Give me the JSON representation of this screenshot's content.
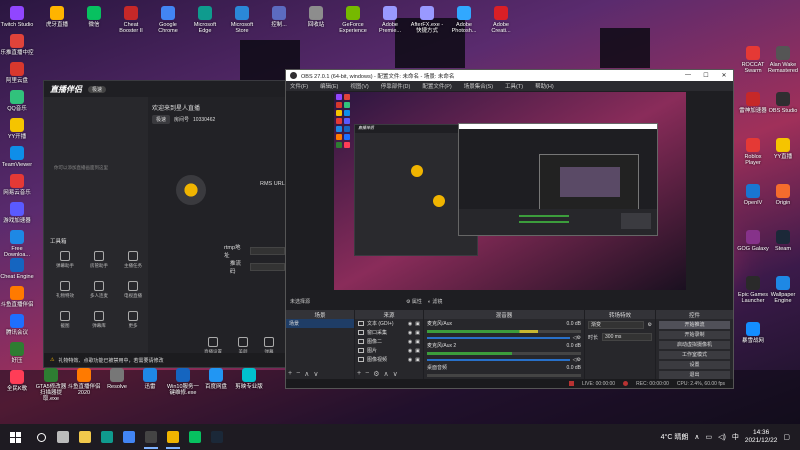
{
  "desktop": {
    "left_icons": [
      {
        "label": "Twitch Studio",
        "color": "#9146ff"
      },
      {
        "label": "乐推直播中控",
        "color": "#e0433a"
      },
      {
        "label": "阿里云盘",
        "color": "#d8382d"
      },
      {
        "label": "QQ音乐",
        "color": "#31c27c"
      },
      {
        "label": "YY开播",
        "color": "#f5c400"
      },
      {
        "label": "TeamViewer",
        "color": "#0e8ee9"
      },
      {
        "label": "网易云音乐",
        "color": "#e53935"
      },
      {
        "label": "游戏加速器",
        "color": "#5a5aff"
      },
      {
        "label": "Free Downloa...",
        "color": "#1e88e5"
      },
      {
        "label": "Cheat Engine",
        "color": "#1565c0"
      },
      {
        "label": "斗鱼直播伴侣",
        "color": "#ff7a00"
      },
      {
        "label": "腾讯会议",
        "color": "#1e6fff"
      },
      {
        "label": "好压",
        "color": "#2e7d32"
      },
      {
        "label": "全民K歌",
        "color": "#ff3d57"
      }
    ],
    "top_icons": [
      {
        "label": "虎牙直播",
        "color": "#ffb400"
      },
      {
        "label": "微信",
        "color": "#07c160"
      },
      {
        "label": "Cheat Booster II",
        "color": "#c62828"
      },
      {
        "label": "Google Chrome",
        "color": "#4285f4"
      },
      {
        "label": "Microsoft Edge",
        "color": "#0f9b8e"
      },
      {
        "label": "Microsoft Store",
        "color": "#2b88d8"
      },
      {
        "label": "控制...",
        "color": "#5c6bc0"
      },
      {
        "label": "回收站",
        "color": "#8d8d8d"
      },
      {
        "label": "GeForce Experience",
        "color": "#76b900"
      },
      {
        "label": "Adobe Premie...",
        "color": "#9999ff"
      },
      {
        "label": "AfterFX.exe - 快捷方式",
        "color": "#9999ff"
      },
      {
        "label": "Adobe Photosh...",
        "color": "#31a8ff"
      },
      {
        "label": "Adobe Creati...",
        "color": "#da1f26"
      }
    ],
    "bottom_icons": [
      {
        "label": "GTA5修改器 扫描器提取.exe",
        "color": "#2e7d32"
      },
      {
        "label": "斗鱼直播伴侣 2020",
        "color": "#ff7a00"
      },
      {
        "label": "Resolve",
        "color": "#777777"
      },
      {
        "label": "迅雷",
        "color": "#1e88e5"
      },
      {
        "label": "Win10服务一键维修.exe",
        "color": "#1565c0"
      },
      {
        "label": "百度网盘",
        "color": "#2196f3"
      },
      {
        "label": "剪映专业版",
        "color": "#00c1cd"
      }
    ],
    "right_icons": [
      {
        "label": "ROCCAT Swarm",
        "color": "#e53935"
      },
      {
        "label": "Alan Wake Remastered",
        "color": "#555555"
      },
      {
        "label": "雷神加速器",
        "color": "#c62828"
      },
      {
        "label": "OBS Studio",
        "color": "#302e31"
      },
      {
        "label": "Roblox Player",
        "color": "#e53935"
      },
      {
        "label": "YY直播",
        "color": "#f5c400"
      },
      {
        "label": "OpenIV",
        "color": "#1976d2"
      },
      {
        "label": "Origin",
        "color": "#f56c2d"
      },
      {
        "label": "GOG Galaxy",
        "color": "#86328a"
      },
      {
        "label": "Steam",
        "color": "#1b2838"
      },
      {
        "label": "Epic Games Launcher",
        "color": "#2a2a2a"
      },
      {
        "label": "Wallpaper Engine",
        "color": "#1e88e5"
      },
      {
        "label": "Ubisoft Connect",
        "color": "#0070ff"
      },
      {
        "label": "暴雪战网",
        "color": "#148eff"
      }
    ]
  },
  "live_app": {
    "logo": "直播伴侣",
    "badge": "极速",
    "welcome": "欢迎来到星人直播",
    "room_label": "房间号",
    "room_number": "10330462",
    "left_tip": "你可以添加直播画面到这里",
    "tools_title": "工具箱",
    "tools": [
      "弹幕助手",
      "房管助手",
      "主播任务",
      "礼物特效",
      "多人连麦",
      "电视直播",
      "截图",
      "弹幕库",
      "更多"
    ],
    "rtmp_label": "rtmp地址",
    "key_label": "推流码",
    "rms_label": "RMS URL",
    "notice": "礼物特效、点歌功能已被禁用中，若需要请修改",
    "bottom_tools": [
      "直播设置",
      "美颜",
      "弹幕"
    ]
  },
  "obs": {
    "title": "OBS 27.0.1 (64-bit, windows) - 配置文件: 未命名 - 场景: 未命名",
    "menu": [
      "文件(F)",
      "编辑(E)",
      "视图(V)",
      "停靠部件(D)",
      "配置文件(P)",
      "场景集合(S)",
      "工具(T)",
      "帮助(H)"
    ],
    "scene_bar": {
      "label": "未选择源",
      "properties": "属性",
      "filters": "滤镜"
    },
    "docks": {
      "scenes": {
        "title": "场景",
        "items": [
          "场景"
        ]
      },
      "sources": {
        "title": "来源",
        "items": [
          "文本 (GDI+)",
          "窗口采集",
          "图像二",
          "图片",
          "图像视频"
        ]
      },
      "mixer": {
        "title": "混音器",
        "channels": [
          {
            "name": "麦克风/Aux",
            "db": "0.0 dB",
            "level": 0.72
          },
          {
            "name": "麦克风/Aux 2",
            "db": "0.0 dB",
            "level": 0.55
          },
          {
            "name": "桌面音频",
            "db": "0.0 dB",
            "level": 0.0
          }
        ]
      },
      "transitions": {
        "title": "转场特效",
        "type": "渐变",
        "duration_label": "时长",
        "duration": "300 ms"
      },
      "controls": {
        "title": "控件",
        "buttons": [
          "开始推流",
          "开始录制",
          "启动虚拟摄像机",
          "工作室模式",
          "设置",
          "退出"
        ]
      }
    },
    "status": {
      "live": "LIVE: 00:00:00",
      "rec": "REC: 00:00:00",
      "cpu": "CPU: 2.4%, 60.00 fps"
    }
  },
  "taskbar": {
    "weather": "4°C 晴朗",
    "time": "14:36",
    "date": "2021/12/22",
    "lang": "中",
    "apps": [
      {
        "name": "search",
        "color": "#ffffff"
      },
      {
        "name": "task-view",
        "color": "#bbbbbb"
      },
      {
        "name": "explorer",
        "color": "#f2c94c"
      },
      {
        "name": "edge",
        "color": "#0f9b8e"
      },
      {
        "name": "chrome",
        "color": "#4285f4"
      },
      {
        "name": "obs",
        "color": "#444444",
        "active": true
      },
      {
        "name": "live-app",
        "color": "#f0b400",
        "active": true
      },
      {
        "name": "wechat",
        "color": "#07c160"
      },
      {
        "name": "steam",
        "color": "#1b2838"
      }
    ]
  }
}
